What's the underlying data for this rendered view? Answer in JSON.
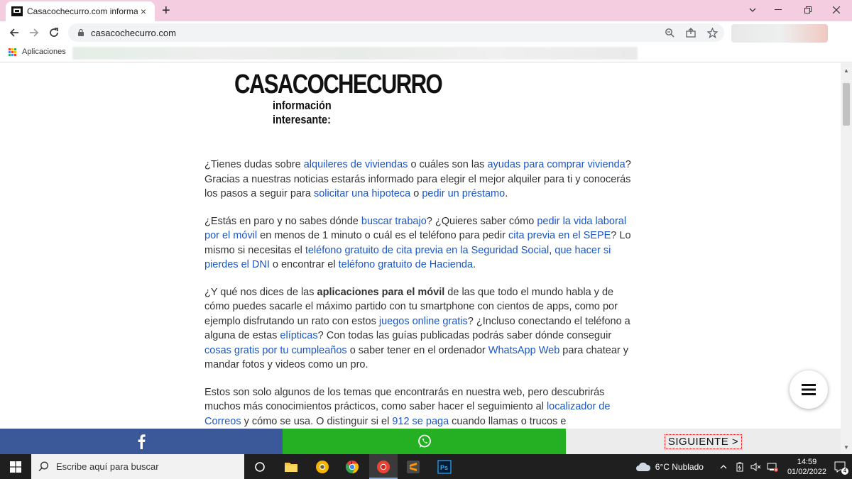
{
  "browser": {
    "tab_title": "Casacochecurro.com información",
    "tab_close": "×",
    "new_tab": "+",
    "url": "casacochecurro.com",
    "bookmarks_apps_label": "Aplicaciones"
  },
  "page": {
    "logo_main": "CASACOCHECURRO",
    "logo_sub": "información interesante:",
    "paragraphs": [
      [
        {
          "t": "¿Tienes dudas sobre "
        },
        {
          "t": "alquileres de viviendas",
          "link": true
        },
        {
          "t": " o cuáles son las "
        },
        {
          "t": "ayudas para comprar vivienda",
          "link": true
        },
        {
          "t": "? Gracias a nuestras noticias estarás informado para elegir el mejor alquiler para ti y conocerás los pasos a seguir para "
        },
        {
          "t": "solicitar una hipoteca",
          "link": true
        },
        {
          "t": " o "
        },
        {
          "t": "pedir un préstamo",
          "link": true
        },
        {
          "t": "."
        }
      ],
      [
        {
          "t": "¿Estás en paro y no sabes dónde "
        },
        {
          "t": "buscar trabajo",
          "link": true
        },
        {
          "t": "? ¿Quieres saber cómo "
        },
        {
          "t": "pedir la vida laboral por el móvil",
          "link": true
        },
        {
          "t": " en menos de 1 minuto o cuál es el teléfono para pedir "
        },
        {
          "t": "cita previa en el SEPE",
          "link": true
        },
        {
          "t": "? Lo mismo si necesitas el "
        },
        {
          "t": "teléfono gratuito de cita previa en la Seguridad Social",
          "link": true
        },
        {
          "t": ", "
        },
        {
          "t": "que hacer si pierdes el DNI",
          "link": true
        },
        {
          "t": " o encontrar el "
        },
        {
          "t": "teléfono gratuito de Hacienda",
          "link": true
        },
        {
          "t": "."
        }
      ],
      [
        {
          "t": "¿Y qué nos dices de las "
        },
        {
          "t": "aplicaciones para el móvil",
          "bold": true
        },
        {
          "t": " de las que todo el mundo habla y de cómo puedes sacarle el máximo partido con tu smartphone con cientos de apps, como por ejemplo disfrutando un rato con estos "
        },
        {
          "t": "juegos online gratis",
          "link": true
        },
        {
          "t": "? ¿Incluso conectando el teléfono a alguna de estas "
        },
        {
          "t": "elípticas",
          "link": true
        },
        {
          "t": "? Con todas las guías publicadas podrás saber dónde conseguir "
        },
        {
          "t": "cosas gratis por tu cumpleaños",
          "link": true
        },
        {
          "t": " o saber tener en el ordenador "
        },
        {
          "t": "WhatsApp Web",
          "link": true
        },
        {
          "t": " para chatear y mandar fotos y videos como un pro."
        }
      ],
      [
        {
          "t": "Estos son solo algunos de los temas que encontrarás en nuestra web, pero descubrirás muchos más conocimientos prácticos, como saber hacer el seguimiento al "
        },
        {
          "t": "localizador de Correos",
          "link": true
        },
        {
          "t": " y cómo se usa. O distinguir si el "
        },
        {
          "t": "912 se paga",
          "link": true
        },
        {
          "t": " cuando llamas o trucos e"
        }
      ]
    ],
    "next_button": "SIGUIENTE >"
  },
  "taskbar": {
    "search_placeholder": "Escribe aquí para buscar",
    "weather": "6°C  Nublado",
    "time": "14:59",
    "date": "01/02/2022",
    "notifications": "4"
  },
  "colors": {
    "tabbar": "#f4cde0",
    "link": "#1a56c8",
    "facebook": "#3b5998",
    "whatsapp": "#25b024"
  }
}
